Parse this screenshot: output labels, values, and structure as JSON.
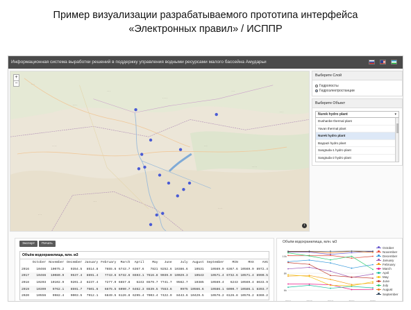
{
  "slide": {
    "title_line1": "Пример визуализации разрабатываемого прототипа интерфейса",
    "title_line2": "«Электронных правил» / ИСППР"
  },
  "app": {
    "title": "Информационная система выработки решений в поддержку управления водными ресурсами малого бассейна Амударьи",
    "flags": [
      "russian-flag",
      "us-flag",
      "uzbek-flag"
    ],
    "map": {
      "zoom_in": "+",
      "zoom_out": "−",
      "info": "i",
      "marker_color": "#4a5bd4",
      "markers": [
        {
          "x": 0.42,
          "y": 0.24
        },
        {
          "x": 0.47,
          "y": 0.43
        },
        {
          "x": 0.44,
          "y": 0.52
        },
        {
          "x": 0.43,
          "y": 0.61
        },
        {
          "x": 0.45,
          "y": 0.6
        },
        {
          "x": 0.57,
          "y": 0.49
        },
        {
          "x": 0.6,
          "y": 0.7
        },
        {
          "x": 0.58,
          "y": 0.74
        },
        {
          "x": 0.56,
          "y": 0.78
        },
        {
          "x": 0.49,
          "y": 0.9
        },
        {
          "x": 0.47,
          "y": 0.96
        },
        {
          "x": 0.51,
          "y": 0.89
        },
        {
          "x": 0.69,
          "y": 0.27
        },
        {
          "x": 0.5,
          "y": 0.65
        },
        {
          "x": 0.53,
          "y": 0.7
        }
      ]
    },
    "layer_panel": {
      "header": "Выберите Слой",
      "options": [
        {
          "label": "Гидропосты",
          "checked": false
        },
        {
          "label": "Гидроэлектростанции",
          "checked": true
        }
      ]
    },
    "object_panel": {
      "header": "Выберите Объект",
      "selected": "Nurek hydro plant",
      "items": [
        {
          "label": "Dushanbe thermal plant",
          "selected": false
        },
        {
          "label": "Yavan thermal plant",
          "selected": false
        },
        {
          "label": "Nurek hydro plant",
          "selected": true
        },
        {
          "label": "Baypazi hydro plant",
          "selected": false
        },
        {
          "label": "Sangtuda-1 hydro plant",
          "selected": false
        },
        {
          "label": "Sangtuda-2 hydro plant",
          "selected": false
        }
      ]
    },
    "toolbar": {
      "export_label": "Экспорт",
      "print_label": "Печать"
    },
    "table": {
      "title": "Объём водохранилища, млн. м3",
      "columns": [
        "",
        "October",
        "November",
        "December",
        "January",
        "February",
        "March",
        "April",
        "May",
        "June",
        "July",
        "August",
        "September",
        "MIN",
        "MAX",
        "AVG"
      ],
      "rows": [
        [
          "2016",
          "10466",
          "10075.2",
          "9354.5",
          "8514.8",
          "7655.6",
          "6743.7",
          "6367.6",
          "7821",
          "9252.6",
          "10386.6",
          "10531",
          "10569.9",
          "6367.6",
          "10569.9",
          "8972.4"
        ],
        [
          "2017",
          "10466",
          "10080.9",
          "9537.4",
          "8691.4",
          "7743.6",
          "6732.6",
          "6593.1",
          "7616.8",
          "9039.9",
          "10029.3",
          "10543",
          "10571.4",
          "6732.6",
          "10571.4",
          "8990.5"
        ],
        [
          "2018",
          "10203",
          "10102.9",
          "9201.2",
          "8237.4",
          "7277.9",
          "6657.8",
          "6243",
          "6579.7",
          "7741.7",
          "9562.7",
          "10385",
          "10569.4",
          "6243",
          "10569.4",
          "8633.9"
        ],
        [
          "2019",
          "10399",
          "9762.1",
          "8591.7",
          "7501.6",
          "6675.5",
          "6090.7",
          "6462.3",
          "6539.5",
          "7553.6",
          "9975",
          "10566.6",
          "10586.1",
          "6090.7",
          "10586.1",
          "8393.7"
        ],
        [
          "2020",
          "10556",
          "9982.4",
          "9003.5",
          "7912.1",
          "6849.5",
          "6126.8",
          "6295.4",
          "7003.4",
          "7422.9",
          "8443.6",
          "10429.5",
          "10576.2",
          "6126.8",
          "10576.2",
          "8369.2"
        ]
      ]
    },
    "chart": {
      "title": "Объём водохранилища, млн. м3"
    }
  },
  "chart_data": {
    "type": "line",
    "title": "Объём водохранилища, млн. м3",
    "x": [
      "2016",
      "2017",
      "2018",
      "2019",
      "2020"
    ],
    "y_ticks": [
      "10k",
      "8k",
      "6k"
    ],
    "ylim": [
      5000,
      11000
    ],
    "grid": true,
    "legend_position": "right",
    "series": [
      {
        "name": "October",
        "color": "#6a5acd",
        "values": [
          10466,
          10466,
          10203,
          10399,
          10556
        ]
      },
      {
        "name": "November",
        "color": "#e74c3c",
        "values": [
          10075.2,
          10080.9,
          10102.9,
          9762.1,
          9982.4
        ]
      },
      {
        "name": "December",
        "color": "#3498db",
        "values": [
          9354.5,
          9537.4,
          9201.2,
          8591.7,
          9003.5
        ]
      },
      {
        "name": "January",
        "color": "#9b59b6",
        "values": [
          8514.8,
          8691.4,
          8237.4,
          7501.6,
          7912.1
        ]
      },
      {
        "name": "February",
        "color": "#f39c12",
        "values": [
          7655.6,
          7743.6,
          7277.9,
          6675.5,
          6849.5
        ]
      },
      {
        "name": "March",
        "color": "#e91e8c",
        "values": [
          6743.7,
          6732.6,
          6657.8,
          6090.7,
          6126.8
        ]
      },
      {
        "name": "April",
        "color": "#1abc9c",
        "values": [
          6367.6,
          6593.1,
          6243,
          6462.3,
          6295.4
        ]
      },
      {
        "name": "May",
        "color": "#f1c40f",
        "values": [
          7821,
          7616.8,
          6579.7,
          6539.5,
          7003.4
        ]
      },
      {
        "name": "June",
        "color": "#c0392b",
        "values": [
          9252.6,
          9039.9,
          7741.7,
          7553.6,
          7422.9
        ]
      },
      {
        "name": "July",
        "color": "#2ecc71",
        "values": [
          10386.6,
          10029.3,
          9562.7,
          9975,
          8443.6
        ]
      },
      {
        "name": "August",
        "color": "#e67e22",
        "values": [
          10531,
          10543,
          10385,
          10566.6,
          10429.5
        ]
      },
      {
        "name": "September",
        "color": "#34495e",
        "values": [
          10569.9,
          10571.4,
          10569.4,
          10586.1,
          10576.2
        ]
      }
    ]
  }
}
